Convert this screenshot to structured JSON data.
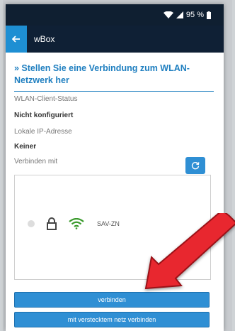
{
  "statusbar": {
    "battery_text": "95 %"
  },
  "appbar": {
    "title": "wBox"
  },
  "page": {
    "heading": "» Stellen Sie eine Verbindung zum WLAN-Netzwerk her"
  },
  "fields": [
    {
      "label": "WLAN-Client-Status"
    },
    {
      "value": "Nicht konfiguriert"
    },
    {
      "label": "Lokale IP-Adresse"
    },
    {
      "value": "Keiner"
    },
    {
      "label": "Verbinden mit"
    }
  ],
  "networks": [
    {
      "ssid": "SAV-ZN"
    }
  ],
  "buttons": {
    "connect": "verbinden",
    "connect_hidden": "mit verstecktem netz verbinden"
  },
  "colors": {
    "accent": "#2f8fd4",
    "appbar": "#0f2035",
    "arrow": "#e8272f",
    "wifi": "#3a9a2d"
  }
}
